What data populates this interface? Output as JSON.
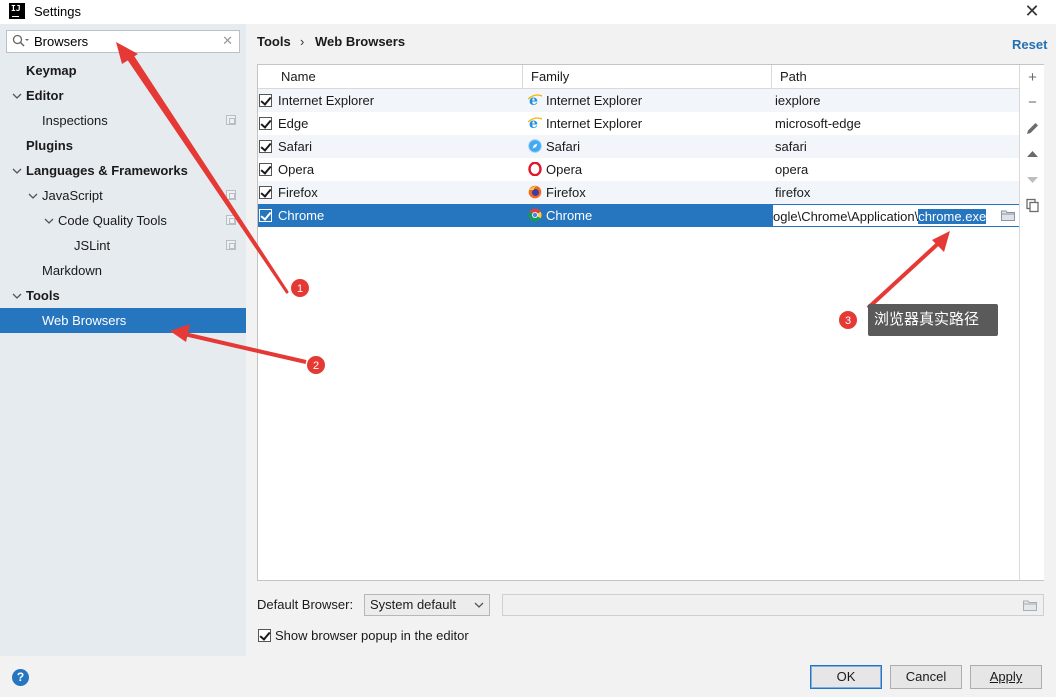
{
  "window": {
    "title": "Settings",
    "app_icon_text": "IJ"
  },
  "sidebar": {
    "search_value": "Browsers",
    "items": [
      {
        "label": "Keymap"
      },
      {
        "label": "Editor"
      },
      {
        "label": "Inspections"
      },
      {
        "label": "Plugins"
      },
      {
        "label": "Languages & Frameworks"
      },
      {
        "label": "JavaScript"
      },
      {
        "label": "Code Quality Tools"
      },
      {
        "label": "JSLint"
      },
      {
        "label": "Markdown"
      },
      {
        "label": "Tools"
      },
      {
        "label": "Web Browsers"
      }
    ]
  },
  "breadcrumb": {
    "parent": "Tools",
    "separator": "›",
    "current": "Web Browsers"
  },
  "reset_label": "Reset",
  "table": {
    "headers": {
      "name": "Name",
      "family": "Family",
      "path": "Path"
    },
    "rows": [
      {
        "name": "Internet Explorer",
        "family": "Internet Explorer",
        "path": "iexplore",
        "icon": "ie-icon",
        "checked": true
      },
      {
        "name": "Edge",
        "family": "Internet Explorer",
        "path": "microsoft-edge",
        "icon": "ie-icon",
        "checked": true
      },
      {
        "name": "Safari",
        "family": "Safari",
        "path": "safari",
        "icon": "safari-icon",
        "checked": true
      },
      {
        "name": "Opera",
        "family": "Opera",
        "path": "opera",
        "icon": "opera-icon",
        "checked": true
      },
      {
        "name": "Firefox",
        "family": "Firefox",
        "path": "firefox",
        "icon": "firefox-icon",
        "checked": true
      },
      {
        "name": "Chrome",
        "family": "Chrome",
        "path_prefix": "ogle\\Chrome\\Application\\",
        "path_selected": "chrome.exe",
        "icon": "chrome-icon",
        "checked": true,
        "selected": true
      }
    ]
  },
  "annotations": {
    "tooltip": "浏览器真实路径",
    "badges": [
      "1",
      "2",
      "3"
    ],
    "color": "#e53935"
  },
  "default_browser": {
    "label": "Default Browser:",
    "value": "System default"
  },
  "popup_checkbox": {
    "label": "Show browser popup in the editor",
    "checked": true
  },
  "buttons": {
    "ok": "OK",
    "cancel": "Cancel",
    "apply": "Apply"
  },
  "colors": {
    "selection": "#2675bf",
    "link": "#2470b3",
    "sidebar_bg": "#e6ebf0"
  }
}
